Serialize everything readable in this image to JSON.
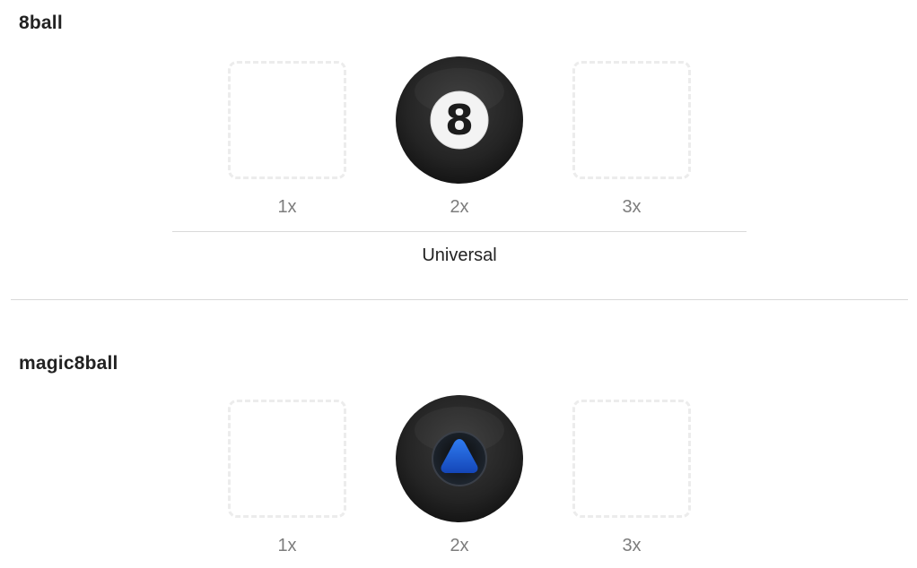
{
  "asset_sets": [
    {
      "name": "8ball",
      "slots": [
        {
          "scale": "1x",
          "filled": false
        },
        {
          "scale": "2x",
          "filled": true,
          "image": "eight-ball"
        },
        {
          "scale": "3x",
          "filled": false
        }
      ],
      "group_label": "Universal"
    },
    {
      "name": "magic8ball",
      "slots": [
        {
          "scale": "1x",
          "filled": false
        },
        {
          "scale": "2x",
          "filled": true,
          "image": "magic-eight-ball"
        },
        {
          "scale": "3x",
          "filled": false
        }
      ]
    }
  ],
  "colors": {
    "ball_dark": "#1f1f1f",
    "ball_light": "#4a4a4a",
    "magic_blue": "#1a5fd6",
    "dashed_border": "#ececec"
  }
}
